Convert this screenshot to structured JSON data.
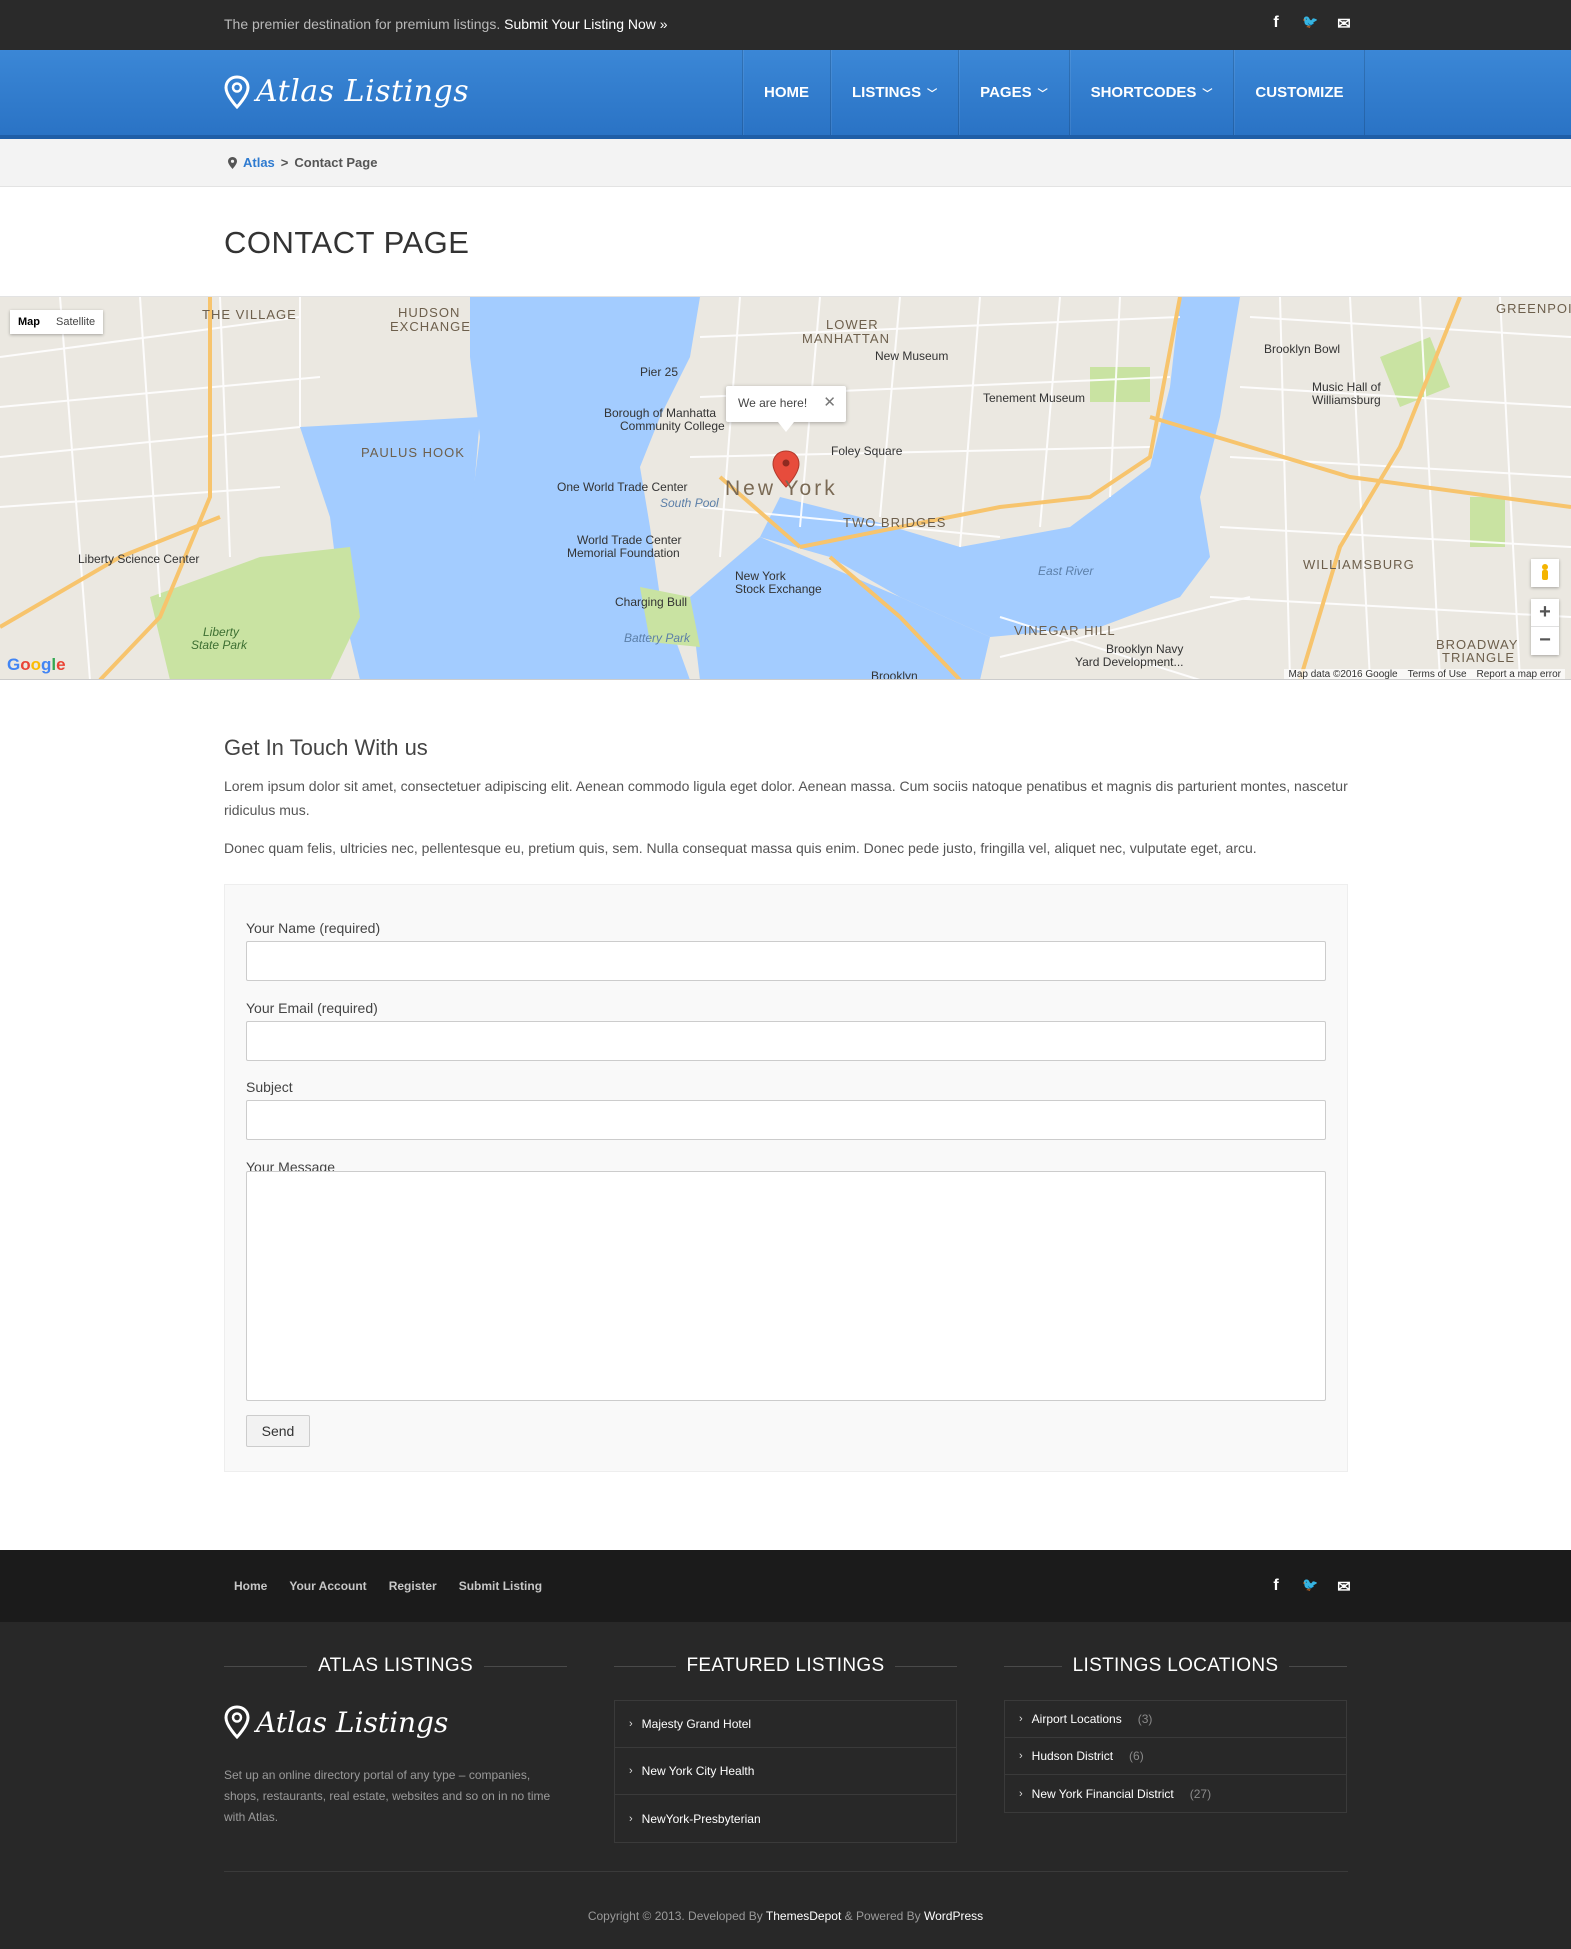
{
  "topbar": {
    "tagline": "The premier destination for premium listings.",
    "submit_link": "Submit Your Listing Now »",
    "social": [
      {
        "icon": "facebook-icon",
        "glyph": "f"
      },
      {
        "icon": "twitter-icon",
        "glyph": "🐦"
      },
      {
        "icon": "mail-icon",
        "glyph": "✉"
      }
    ]
  },
  "header": {
    "logo_text": "Atlas Listings",
    "nav": [
      {
        "label": "HOME",
        "has_dropdown": false
      },
      {
        "label": "LISTINGS",
        "has_dropdown": true
      },
      {
        "label": "PAGES",
        "has_dropdown": true
      },
      {
        "label": "SHORTCODES",
        "has_dropdown": true
      },
      {
        "label": "CUSTOMIZE",
        "has_dropdown": false
      }
    ]
  },
  "breadcrumb": {
    "root": "Atlas",
    "separator": ">",
    "current": "Contact Page"
  },
  "page_title": "CONTACT PAGE",
  "map": {
    "type_controls": [
      "Map",
      "Satellite"
    ],
    "active_type": "Map",
    "marker_popup": "We are here!",
    "labels": {
      "new_york": "New York",
      "the_village": "THE VILLAGE",
      "hudson_exchange": "HUDSON",
      "hudson_exchange_2": "EXCHANGE",
      "lower_manhattan": "LOWER",
      "lower_manhattan_2": "MANHATTAN",
      "greenpoint": "GREENPOIN",
      "paulus_hook": "PAULUS HOOK",
      "two_bridges": "TWO BRIDGES",
      "williamsburg": "WILLIAMSBURG",
      "vinegar_hill": "VINEGAR HILL",
      "broadway_triangle": "BROADWAY",
      "broadway_triangle_2": "TRIANGLE",
      "pier_25": "Pier 25",
      "new_museum": "New Museum",
      "tenement_museum": "Tenement Museum",
      "brooklyn_bowl": "Brooklyn Bowl",
      "music_hall": "Music Hall of",
      "music_hall_2": "Williamsburg",
      "bmcc": "Borough of Manhatta",
      "bmcc_2": "Community College",
      "foley_square": "Foley Square",
      "one_wtc": "One World Trade Center",
      "south_pool": "South Pool",
      "wtc_memorial": "World Trade Center",
      "wtc_memorial_2": "Memorial Foundation",
      "nyse": "New York",
      "nyse_2": "Stock Exchange",
      "charging_bull": "Charging Bull",
      "battery_park": "Battery Park",
      "liberty_science": "Liberty Science Center",
      "liberty_park": "Liberty",
      "liberty_park_2": "State Park",
      "east_river": "East River",
      "navy_yard": "Brooklyn Navy",
      "navy_yard_2": "Yard Development...",
      "brooklyn": "Brooklyn"
    },
    "zoom_in": "+",
    "zoom_out": "−",
    "google": "Google",
    "attribution": [
      "Map data ©2016 Google",
      "Terms of Use",
      "Report a map error"
    ]
  },
  "contact": {
    "heading": "Get In Touch With us",
    "paragraph_1": "Lorem ipsum dolor sit amet, consectetuer adipiscing elit. Aenean commodo ligula eget dolor. Aenean massa. Cum sociis natoque penatibus et magnis dis parturient montes, nascetur ridiculus mus.",
    "paragraph_2": "Donec quam felis, ultricies nec, pellentesque eu, pretium quis, sem. Nulla consequat massa quis enim. Donec pede justo, fringilla vel, aliquet nec, vulputate eget, arcu.",
    "form": {
      "name_label": "Your Name (required)",
      "email_label": "Your Email (required)",
      "subject_label": "Subject",
      "message_label": "Your Message",
      "name_value": "",
      "email_value": "",
      "subject_value": "",
      "message_value": "",
      "send_label": "Send"
    }
  },
  "footer_bar": {
    "links": [
      "Home",
      "Your Account",
      "Register",
      "Submit Listing"
    ]
  },
  "footer": {
    "col1_title": "ATLAS LISTINGS",
    "logo_text": "Atlas Listings",
    "description": "Set up an online directory portal of any type – companies, shops, restaurants, real estate, websites and so on in no time with Atlas.",
    "col2_title": "FEATURED LISTINGS",
    "featured": [
      "Majesty Grand Hotel",
      "New York City Health",
      "NewYork-Presbyterian"
    ],
    "col3_title": "LISTINGS LOCATIONS",
    "locations": [
      {
        "name": "Airport Locations",
        "count": "(3)"
      },
      {
        "name": "Hudson District",
        "count": "(6)"
      },
      {
        "name": "New York Financial District",
        "count": "(27)"
      }
    ],
    "copyright_prefix": "Copyright © 2013. Developed By",
    "developer": "ThemesDepot",
    "powered_prefix": "& Powered By",
    "platform": "WordPress"
  },
  "colors": {
    "brand_blue": "#2f7bd0",
    "topbar_bg": "#2a2a2a",
    "footer_bg": "#282828",
    "water": "#a3ccff",
    "park": "#c9e3a2",
    "road": "#f7c46d"
  }
}
